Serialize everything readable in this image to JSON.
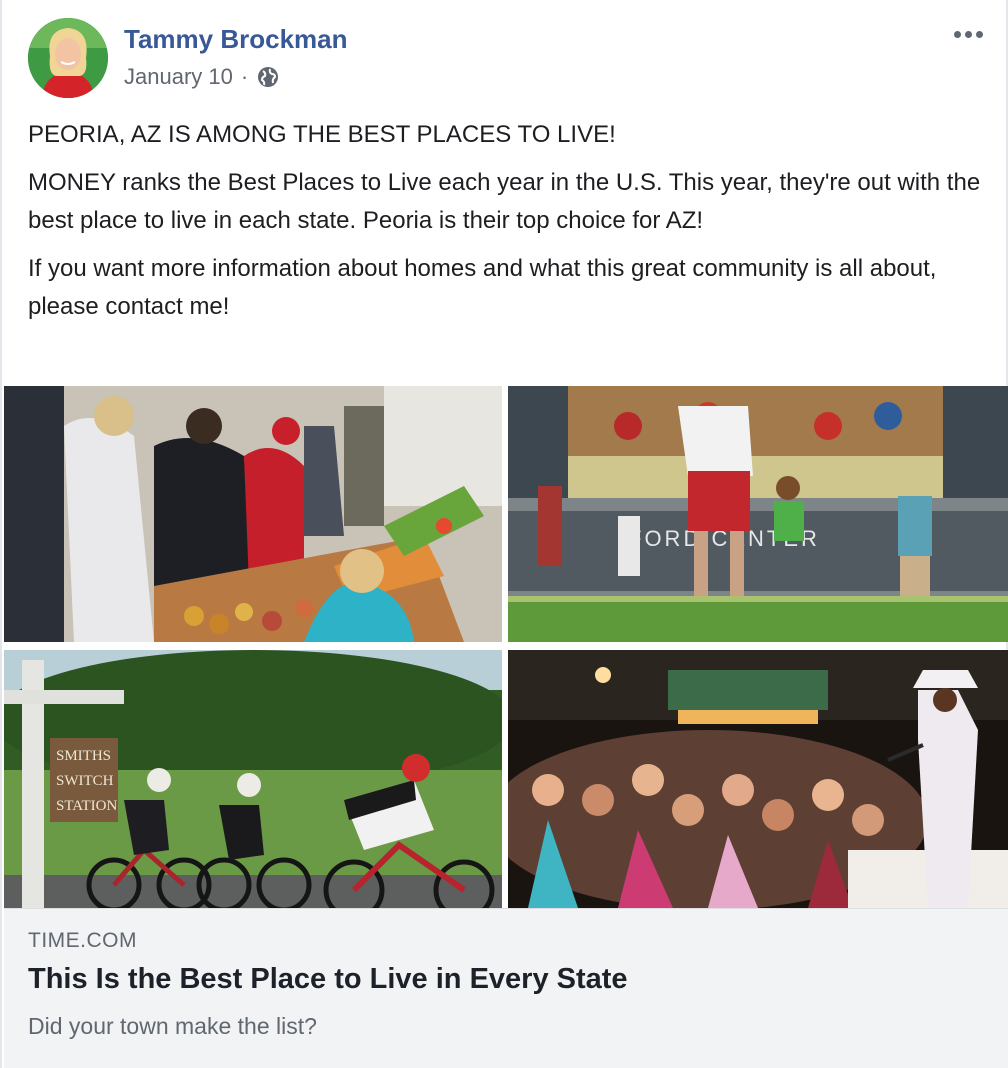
{
  "author": {
    "name": "Tammy Brockman",
    "date": "January 10",
    "separator": "·"
  },
  "icons": {
    "avatar": "profile-photo",
    "privacy": "globe-icon",
    "options": "more-options-icon"
  },
  "post": {
    "paragraphs": [
      "PEORIA, AZ IS AMONG THE BEST PLACES TO LIVE!",
      "MONEY ranks the Best Places to Live each year in the U.S. This year, they're out with the best place to live in each state. Peoria is their top choice for AZ!",
      "If you want more information about homes and what this great community is all about, please contact me!"
    ]
  },
  "images": {
    "sign_lines": [
      "SMITHS",
      "SWITCH",
      "STATION"
    ],
    "building_sign": "FORD CENTER"
  },
  "link_preview": {
    "domain": "TIME.COM",
    "title": "This Is the Best Place to Live in Every State",
    "description": "Did your town make the list?"
  },
  "colors": {
    "author_blue": "#385898",
    "meta_gray": "#606770",
    "preview_bg": "#f2f3f5"
  }
}
